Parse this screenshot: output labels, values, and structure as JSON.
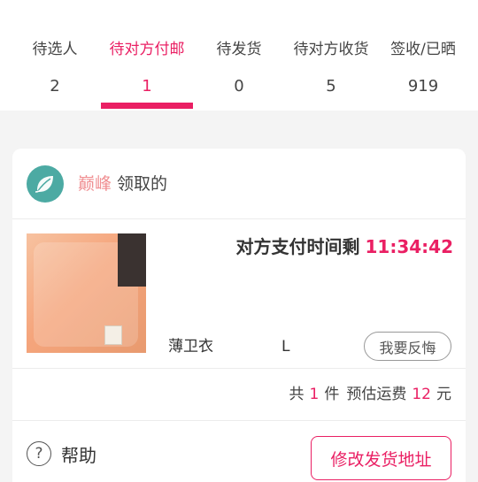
{
  "tabs": [
    {
      "label": "待选人",
      "count": "2",
      "active": false
    },
    {
      "label": "待对方付邮",
      "count": "1",
      "active": true
    },
    {
      "label": "待发货",
      "count": "0",
      "active": false
    },
    {
      "label": "待对方收货",
      "count": "5",
      "active": false
    },
    {
      "label": "签收/已晒",
      "count": "919",
      "active": false
    }
  ],
  "card": {
    "claimer": {
      "name": "巅峰",
      "suffix": "领取的"
    },
    "timer": {
      "label": "对方支付时间剩",
      "time": "11:34:42"
    },
    "item": {
      "name": "薄卫衣",
      "size": "L",
      "regret_label": "我要反悔"
    },
    "summary": {
      "prefix": "共",
      "count": "1",
      "unit": "件",
      "shipping_label": "预估运费",
      "shipping_fee": "12",
      "currency": "元"
    },
    "help_label": "帮助",
    "address_button": "修改发货地址"
  },
  "colors": {
    "accent": "#ea1f63",
    "claimer_name": "#f08f92",
    "avatar_bg": "#4caaa3"
  },
  "icons": {
    "avatar": "leaf-logo-icon",
    "help": "question-circle-icon"
  }
}
